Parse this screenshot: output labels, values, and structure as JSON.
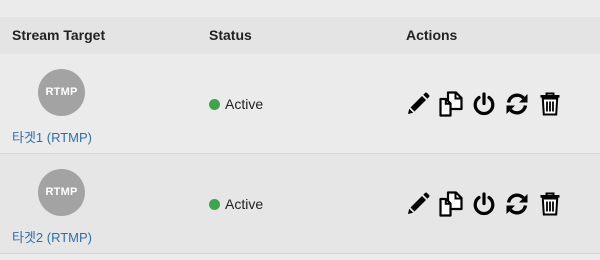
{
  "table": {
    "headers": {
      "target": "Stream Target",
      "status": "Status",
      "actions": "Actions"
    },
    "rows": [
      {
        "avatar_label": "RTMP",
        "target_name": "타겟1 (RTMP)",
        "status": "Active",
        "status_color": "#3fa34d",
        "actions": [
          "edit-icon",
          "copy-icon",
          "power-icon",
          "refresh-icon",
          "delete-icon"
        ]
      },
      {
        "avatar_label": "RTMP",
        "target_name": "타겟2 (RTMP)",
        "status": "Active",
        "status_color": "#3fa34d",
        "actions": [
          "edit-icon",
          "copy-icon",
          "power-icon",
          "refresh-icon",
          "delete-icon"
        ]
      }
    ]
  },
  "colors": {
    "link": "#2f6fa8",
    "avatar": "#a3a3a3",
    "active": "#3fa34d"
  }
}
